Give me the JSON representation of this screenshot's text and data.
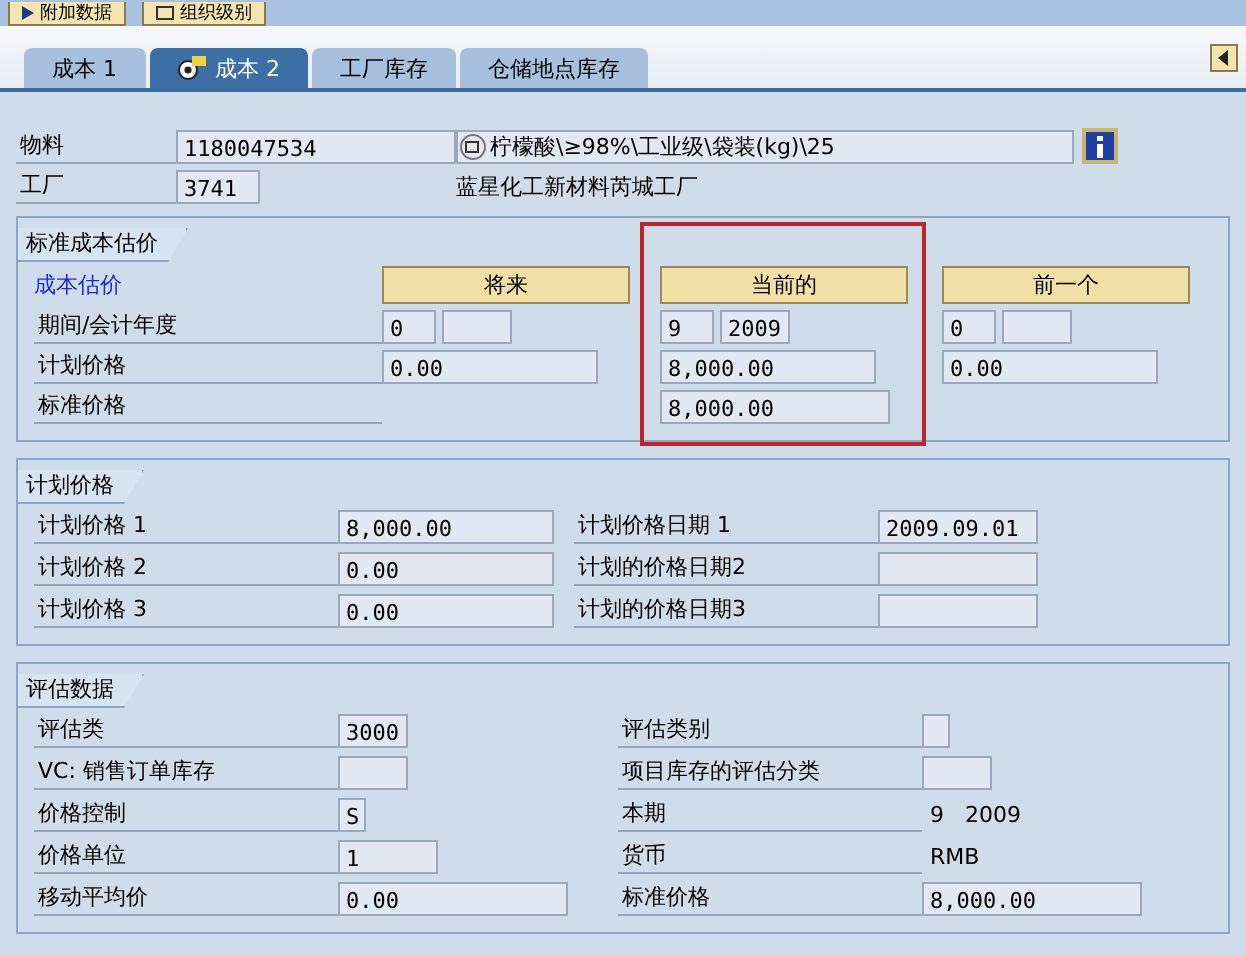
{
  "toolbar": {
    "buttons": [
      {
        "label": "附加数据",
        "kind": "play"
      },
      {
        "label": "组织级别",
        "kind": "org"
      }
    ]
  },
  "tabs": [
    {
      "label": "成本 1",
      "selected": false
    },
    {
      "label": "成本 2",
      "selected": true
    },
    {
      "label": "工厂库存",
      "selected": false
    },
    {
      "label": "仓储地点库存",
      "selected": false
    }
  ],
  "header": {
    "material_label": "物料",
    "material": "1180047534",
    "material_description": "柠檬酸\\≥98%\\工业级\\袋装(kg)\\25",
    "plant_label": "工厂",
    "plant": "3741",
    "plant_name": "蓝星化工新材料芮城工厂"
  },
  "standard_cost_estimate": {
    "title": "标准成本估价",
    "header_label": "成本估价",
    "row_labels": [
      "期间/会计年度",
      "计划价格",
      "标准价格"
    ],
    "columns": [
      {
        "label": "将来",
        "period": "0",
        "planned_price": "0.00",
        "highlighted": false
      },
      {
        "label": "当前的",
        "period": "9",
        "year": "2009",
        "planned_price": "8,000.00",
        "standard_price": "8,000.00",
        "highlighted": true
      },
      {
        "label": "前一个",
        "period": "0",
        "planned_price": "0.00",
        "highlighted": false
      }
    ]
  },
  "planned_prices": {
    "title": "计划价格",
    "rows": [
      {
        "label": "计划价格 1",
        "value": "8,000.00",
        "date_label": "计划价格日期 1",
        "date": "2009.09.01"
      },
      {
        "label": "计划价格 2",
        "value": "0.00",
        "date_label": "计划的价格日期2"
      },
      {
        "label": "计划价格 3",
        "value": "0.00",
        "date_label": "计划的价格日期3"
      }
    ]
  },
  "valuation_data": {
    "title": "评估数据",
    "left": [
      {
        "label": "评估类",
        "value": "3000"
      },
      {
        "label": "VC: 销售订单库存"
      },
      {
        "label": "价格控制",
        "value": "S"
      },
      {
        "label": "价格单位",
        "value": "1"
      },
      {
        "label": "移动平均价",
        "value": "0.00"
      }
    ],
    "right": [
      {
        "label": "评估类别",
        "kind": "field"
      },
      {
        "label": "项目库存的评估分类",
        "kind": "field"
      },
      {
        "label": "本期",
        "value": "9   2009",
        "kind": "text"
      },
      {
        "label": "货币",
        "value": "RMB",
        "kind": "text"
      },
      {
        "label": "标准价格",
        "value": "8,000.00",
        "kind": "field"
      }
    ]
  }
}
